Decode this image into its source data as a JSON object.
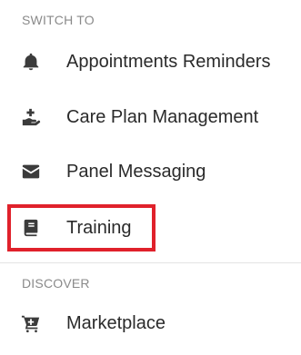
{
  "switch_to": {
    "header": "SWITCH TO",
    "items": [
      {
        "label": "Appointments Reminders",
        "icon": "bell-icon"
      },
      {
        "label": "Care Plan Management",
        "icon": "hand-plus-icon"
      },
      {
        "label": "Panel Messaging",
        "icon": "envelope-icon"
      },
      {
        "label": "Training",
        "icon": "book-icon"
      }
    ]
  },
  "discover": {
    "header": "DISCOVER",
    "items": [
      {
        "label": "Marketplace",
        "icon": "cart-plus-icon"
      }
    ]
  },
  "colors": {
    "highlight_border": "#e0212b",
    "icon": "#3b3b3b",
    "header_text": "#8a8a8a"
  }
}
